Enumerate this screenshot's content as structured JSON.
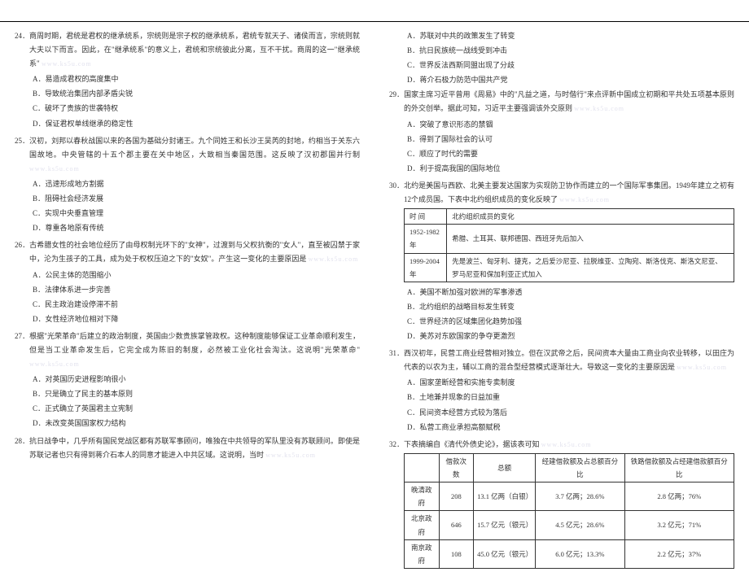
{
  "watermark": "www.ks5u.com",
  "left": {
    "q24": {
      "stem": "24．商周时期，君统是君权的继承统系，宗统则是宗子权的继承统系，君统专就天子、诸侯而言，宗统则就大夫以下而言。因此，在\"继承统系\"的意义上，君统和宗统彼此分离，互不干扰。商周的这一\"继承统系\"",
      "a": "A．易造成君权的高度集中",
      "b": "B．导致统治集团内部矛盾尖锐",
      "c": "C．破坏了贵族的世袭特权",
      "d": "D．保证君权单线继承的稳定性"
    },
    "q25": {
      "stem": "25．汉初，刘邦以春秋战国以来的各国为基础分封诸王。九个同姓王和长沙王吴芮的封地，约相当于关东六国故地。中央管辖的十五个郡主要在关中地区，大致相当秦国范围。这反映了汉初郡国并行制",
      "a": "A．迅速形成地方割据",
      "b": "B．阻碍社会经济发展",
      "c": "C．实现中央垂直管理",
      "d": "D．尊重各地原有传统"
    },
    "q26": {
      "stem": "26．古希腊女性的社会地位经历了由母权制光环下的\"女神\"，过渡到与父权抗衡的\"女人\"，直至被囚禁于家中，沦为生孩子的工具，成为处于权权压迫之下的\"女奴\"。产生这一变化的主要原因是",
      "a": "A．公民主体的范围缩小",
      "b": "B．法律体系进一步完善",
      "c": "C．民主政治建设停滞不前",
      "d": "D．女性经济地位相对下降"
    },
    "q27": {
      "stem": "27．根据\"光荣革命\"后建立的政治制度，英国由少数贵族掌管政权。这种制度能够保证工业革命顺利发生，但是当工业革命发生后，它完全成为陈旧的制度，必然被工业化社会淘汰。这说明\"光荣革命\"",
      "a": "A．对英国历史进程影响很小",
      "b": "B．只是确立了民主的基本原则",
      "c": "C．正式确立了英国君主立宪制",
      "d": "D．未改变英国国家权力结构"
    },
    "q28": {
      "stem": "28．抗日战争中，几乎所有国民党战区都有苏联军事顾问，唯独在中共领导的军队里没有苏联顾问。即使是苏联记者也只有得到蒋介石本人的同意才能进入中共区域。这说明，当时"
    }
  },
  "right": {
    "q28_opts": {
      "a": "A．苏联对中共的政策发生了转变",
      "b": "B．抗日民族统一战线受到冲击",
      "c": "C．世界反法西斯同盟出现了分歧",
      "d": "D．蒋介石极力防范中国共产党"
    },
    "q29": {
      "stem": "29．国家主席习近平曾用《周易》中的\"凡益之道，与时偕行\"来点评新中国成立初期和平共处五项基本原则的外交创举。据此可知，习近平主要强调该外交原则",
      "a": "A．突破了意识形态的禁锢",
      "b": "B．得到了国际社会的认可",
      "c": "C．顺应了时代的需要",
      "d": "D．利于提高我国的国际地位"
    },
    "q30": {
      "stem": "30．北约是美国与西欧、北美主要发达国家为实现防卫协作而建立的一个国际军事集团。1949年建立之初有12个成员国。下表中北约组织成员的变化反映了",
      "table": {
        "header": [
          "时 间",
          "北约组织成员的变化"
        ],
        "rows": [
          [
            "1952-1982年",
            "希腊、土耳其、联邦德国、西班牙先后加入"
          ],
          [
            "1999-2004年",
            "先是波兰、匈牙利、捷克，之后爱沙尼亚、拉脱维亚、立陶宛、斯洛伐克、斯洛文尼亚、罗马尼亚和保加利亚正式加入"
          ]
        ]
      },
      "a": "A．美国不断加强对欧洲的军事渗透",
      "b": "B．北约组织的战略目标发生转变",
      "c": "C．世界经济的区域集团化趋势加强",
      "d": "D．美苏对东欧国家的争夺更激烈"
    },
    "q31": {
      "stem": "31．西汉初年，民营工商业经营相对独立。但在汉武帝之后，民间资本大量由工商业向农业转移，以田庄为代表的以农为主，辅以工商的混合型经营模式逐渐壮大。导致这一变化的主要原因是",
      "a": "A．国家垄断经营和实施专卖制度",
      "b": "B．土地兼并现象的日益加重",
      "c": "C．民间资本经营方式较为落后",
      "d": "D．私营工商业承担高额赋税"
    },
    "q32": {
      "stem": "32．下表摘编自《清代外债史论》，据该表可知",
      "table": {
        "header": [
          "",
          "借款次数",
          "总额",
          "经建借款额及占总额百分比",
          "铁路借款额及占经建借款额百分比"
        ],
        "rows": [
          [
            "晚清政府",
            "208",
            "13.1 亿两（白银）",
            "3.7 亿两；28.6%",
            "2.8 亿两；76%"
          ],
          [
            "北京政府",
            "646",
            "15.7 亿元（银元）",
            "4.5 亿元；28.6%",
            "3.2 亿元；71%"
          ],
          [
            "南京政府",
            "108",
            "45.0 亿元（银元）",
            "6.0 亿元；13.3%",
            "2.2 亿元；37%"
          ]
        ]
      }
    }
  }
}
